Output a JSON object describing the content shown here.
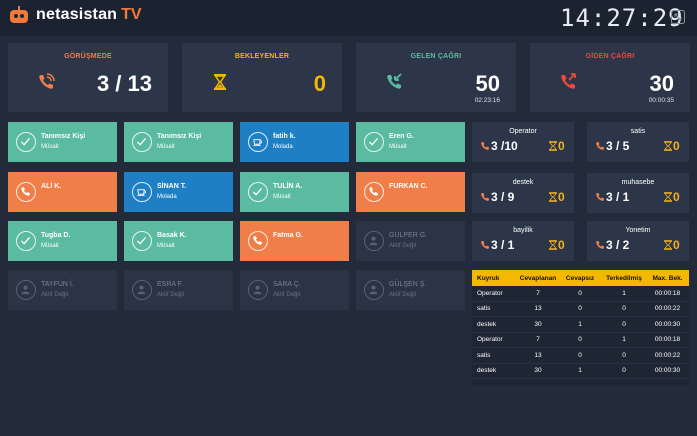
{
  "header": {
    "brand": "netasistan",
    "brand_suffix": "TV",
    "clock": "14:27:29"
  },
  "colors": {
    "accent_orange": "#ef7e48",
    "accent_green": "#5bbba0",
    "accent_blue": "#1f7fc5",
    "accent_yellow": "#f5b800",
    "outgoing_red": "#f0473c"
  },
  "kpis": [
    {
      "title": "GÖRÜŞMEDE",
      "value": "3 / 13",
      "sub": "",
      "title_color": "#ef7e48",
      "icon": "phone-in-call-icon"
    },
    {
      "title": "BEKLEYENLER",
      "value": "0",
      "sub": "",
      "title_color": "#f5b800",
      "icon": "hourglass-icon"
    },
    {
      "title": "GELEN ÇAĞRI",
      "value": "50",
      "sub": "02:23:16",
      "title_color": "#5bbba0",
      "icon": "incoming-call-icon"
    },
    {
      "title": "GİDEN ÇAĞRI",
      "value": "30",
      "sub": "00:00:35",
      "title_color": "#f0473c",
      "icon": "outgoing-call-icon"
    }
  ],
  "agents": [
    {
      "name": "Tanımsız Kişi",
      "status": "Müsait",
      "state": "green",
      "icon": "check-icon"
    },
    {
      "name": "Tanımsız Kişi",
      "status": "Müsait",
      "state": "green",
      "icon": "check-icon"
    },
    {
      "name": "fatih k.",
      "status": "Molada",
      "state": "blue",
      "icon": "coffee-cup-icon"
    },
    {
      "name": "Eren G.",
      "status": "Müsait",
      "state": "green",
      "icon": "check-icon"
    },
    {
      "name": "ALİ K.",
      "status": "",
      "state": "orange",
      "icon": "phone-icon"
    },
    {
      "name": "SİNAN T.",
      "status": "Molada",
      "state": "blue",
      "icon": "coffee-cup-icon"
    },
    {
      "name": "TULİN A.",
      "status": "Müsait",
      "state": "green",
      "icon": "check-icon"
    },
    {
      "name": "FURKAN C.",
      "status": "",
      "state": "orange",
      "icon": "phone-icon"
    },
    {
      "name": "Tugba D.",
      "status": "Müsait",
      "state": "green",
      "icon": "check-icon"
    },
    {
      "name": "Basak K.",
      "status": "Müsait",
      "state": "green",
      "icon": "check-icon"
    },
    {
      "name": "Fatma G.",
      "status": "",
      "state": "orange",
      "icon": "phone-icon"
    },
    {
      "name": "GULPER G.",
      "status": "Aktif Değil",
      "state": "dark",
      "icon": "user-icon"
    },
    {
      "name": "TAYFUN İ.",
      "status": "Aktif Değil",
      "state": "dark",
      "icon": "user-icon"
    },
    {
      "name": "ESRA F.",
      "status": "Aktif Değil",
      "state": "dark",
      "icon": "user-icon"
    },
    {
      "name": "SARA Ç.",
      "status": "Aktif Değil",
      "state": "dark",
      "icon": "user-icon"
    },
    {
      "name": "GÜLŞEN Ş.",
      "status": "Aktif Değil",
      "state": "dark",
      "icon": "user-icon"
    }
  ],
  "queues": [
    {
      "name": "Operator",
      "calls": "3 /10",
      "waiting": "0"
    },
    {
      "name": "satis",
      "calls": "3 / 5",
      "waiting": "0"
    },
    {
      "name": "destek",
      "calls": "3 / 9",
      "waiting": "0"
    },
    {
      "name": "muhasebe",
      "calls": "3 / 1",
      "waiting": "0"
    },
    {
      "name": "bayilik",
      "calls": "3 / 1",
      "waiting": "0"
    },
    {
      "name": "Yonetim",
      "calls": "3 / 2",
      "waiting": "0"
    }
  ],
  "table": {
    "headers": [
      "Kuyruk",
      "Cevaplanan",
      "Cevapsız",
      "Terkedilmiş",
      "Max. Bek."
    ],
    "rows": [
      [
        "Operator",
        "7",
        "0",
        "1",
        "00:00:18"
      ],
      [
        "satis",
        "13",
        "0",
        "0",
        "00:00:22"
      ],
      [
        "destek",
        "30",
        "1",
        "0",
        "00:00:30"
      ],
      [
        "Operator",
        "7",
        "0",
        "1",
        "00:00:18"
      ],
      [
        "satis",
        "13",
        "0",
        "0",
        "00:00:22"
      ],
      [
        "destek",
        "30",
        "1",
        "0",
        "00:00:30"
      ]
    ]
  }
}
